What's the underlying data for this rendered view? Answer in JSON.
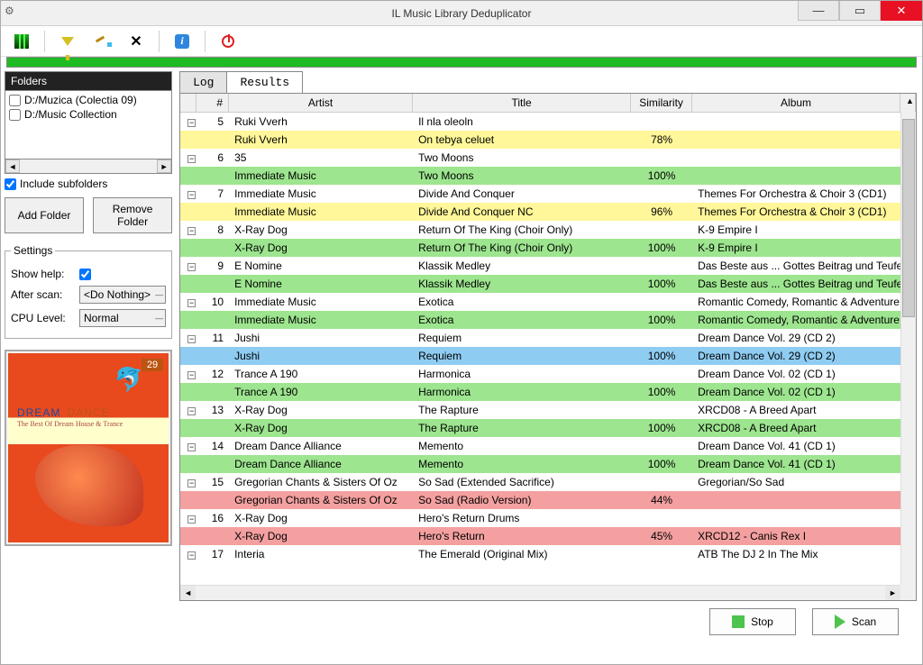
{
  "window": {
    "title": "IL Music Library Deduplicator"
  },
  "toolbar": {
    "scan": "Scan library",
    "filter": "Filter",
    "clean": "Clean",
    "shuffle": "Shuffle",
    "info": "About",
    "power": "Exit"
  },
  "folders": {
    "panel_title": "Folders",
    "items": [
      {
        "path": "D:/Muzica (Colectia 09)",
        "checked": false
      },
      {
        "path": "D:/Music Collection",
        "checked": false
      }
    ],
    "include_subfolders_label": "Include subfolders",
    "include_subfolders": true,
    "add_btn": "Add Folder",
    "remove_btn": "Remove Folder"
  },
  "settings": {
    "legend": "Settings",
    "show_help_label": "Show help:",
    "show_help": true,
    "after_scan_label": "After scan:",
    "after_scan_value": "<Do Nothing>",
    "cpu_label": "CPU Level:",
    "cpu_value": "Normal"
  },
  "album_art": {
    "badge": "29",
    "title_a": "DREAM",
    "title_b": "DANCE",
    "subtitle": "The Best Of Dream House & Trance"
  },
  "tabs": {
    "log": "Log",
    "results": "Results",
    "active": "results"
  },
  "grid": {
    "columns": {
      "num": "#",
      "artist": "Artist",
      "title": "Title",
      "similarity": "Similarity",
      "album": "Album"
    },
    "rows": [
      {
        "n": "5",
        "artist": "Ruki Vverh",
        "title": "Il nla oleoln",
        "sim": "",
        "album": "",
        "cls": "header-row",
        "exp": true
      },
      {
        "n": "",
        "artist": "Ruki Vverh",
        "title": "On tebya celuet",
        "sim": "78%",
        "album": "",
        "cls": "yellow"
      },
      {
        "n": "6",
        "artist": "35",
        "title": "Two Moons",
        "sim": "",
        "album": "",
        "cls": "header-row",
        "exp": true
      },
      {
        "n": "",
        "artist": "Immediate Music",
        "title": "Two Moons",
        "sim": "100%",
        "album": "",
        "cls": "green"
      },
      {
        "n": "7",
        "artist": "Immediate Music",
        "title": "Divide And Conquer",
        "sim": "",
        "album": "Themes For Orchestra & Choir 3 (CD1)",
        "cls": "header-row",
        "exp": true
      },
      {
        "n": "",
        "artist": "Immediate Music",
        "title": "Divide And Conquer NC",
        "sim": "96%",
        "album": "Themes For Orchestra & Choir 3 (CD1)",
        "cls": "yellow"
      },
      {
        "n": "8",
        "artist": "X-Ray Dog",
        "title": "Return Of The King (Choir Only)",
        "sim": "",
        "album": "K-9 Empire I",
        "cls": "header-row",
        "exp": true
      },
      {
        "n": "",
        "artist": "X-Ray Dog",
        "title": "Return Of The King (Choir Only)",
        "sim": "100%",
        "album": "K-9 Empire I",
        "cls": "green"
      },
      {
        "n": "9",
        "artist": "E Nomine",
        "title": "Klassik Medley",
        "sim": "",
        "album": "Das Beste aus ... Gottes Beitrag und Teufels",
        "cls": "header-row",
        "exp": true
      },
      {
        "n": "",
        "artist": "E Nomine",
        "title": "Klassik Medley",
        "sim": "100%",
        "album": "Das Beste aus ... Gottes Beitrag und Teufels",
        "cls": "green"
      },
      {
        "n": "10",
        "artist": "Immediate Music",
        "title": "Exotica",
        "sim": "",
        "album": "Romantic Comedy, Romantic & Adventure",
        "cls": "header-row",
        "exp": true
      },
      {
        "n": "",
        "artist": "Immediate Music",
        "title": "Exotica",
        "sim": "100%",
        "album": "Romantic Comedy, Romantic & Adventure",
        "cls": "green"
      },
      {
        "n": "11",
        "artist": "Jushi",
        "title": "Requiem",
        "sim": "",
        "album": "Dream Dance Vol. 29 (CD 2)",
        "cls": "header-row",
        "exp": true
      },
      {
        "n": "",
        "artist": "Jushi",
        "title": "Requiem",
        "sim": "100%",
        "album": "Dream Dance Vol. 29 (CD 2)",
        "cls": "blue"
      },
      {
        "n": "12",
        "artist": "Trance A 190",
        "title": "Harmonica",
        "sim": "",
        "album": "Dream Dance Vol. 02 (CD 1)",
        "cls": "header-row",
        "exp": true
      },
      {
        "n": "",
        "artist": "Trance A 190",
        "title": "Harmonica",
        "sim": "100%",
        "album": "Dream Dance Vol. 02 (CD 1)",
        "cls": "green"
      },
      {
        "n": "13",
        "artist": "X-Ray Dog",
        "title": "The Rapture",
        "sim": "",
        "album": "XRCD08 - A Breed Apart",
        "cls": "header-row",
        "exp": true
      },
      {
        "n": "",
        "artist": "X-Ray Dog",
        "title": "The Rapture",
        "sim": "100%",
        "album": "XRCD08 - A Breed Apart",
        "cls": "green"
      },
      {
        "n": "14",
        "artist": "Dream Dance Alliance",
        "title": "Memento",
        "sim": "",
        "album": "Dream Dance Vol. 41 (CD 1)",
        "cls": "header-row",
        "exp": true
      },
      {
        "n": "",
        "artist": "Dream Dance Alliance",
        "title": "Memento",
        "sim": "100%",
        "album": "Dream Dance Vol. 41 (CD 1)",
        "cls": "green"
      },
      {
        "n": "15",
        "artist": "Gregorian Chants & Sisters Of Oz",
        "title": "So Sad (Extended Sacrifice)",
        "sim": "",
        "album": "Gregorian/So Sad",
        "cls": "header-row",
        "exp": true
      },
      {
        "n": "",
        "artist": "Gregorian Chants & Sisters Of Oz",
        "title": "So Sad (Radio Version)",
        "sim": "44%",
        "album": "",
        "cls": "pink"
      },
      {
        "n": "16",
        "artist": "X-Ray Dog",
        "title": "Hero's Return Drums",
        "sim": "",
        "album": "",
        "cls": "header-row",
        "exp": true
      },
      {
        "n": "",
        "artist": "X-Ray Dog",
        "title": "Hero's Return",
        "sim": "45%",
        "album": "XRCD12 - Canis Rex I",
        "cls": "pink"
      },
      {
        "n": "17",
        "artist": "Interia",
        "title": "The Emerald (Original Mix)",
        "sim": "",
        "album": "ATB The DJ 2 In The Mix",
        "cls": "header-row",
        "exp": true
      }
    ]
  },
  "actions": {
    "stop": "Stop",
    "scan": "Scan"
  }
}
